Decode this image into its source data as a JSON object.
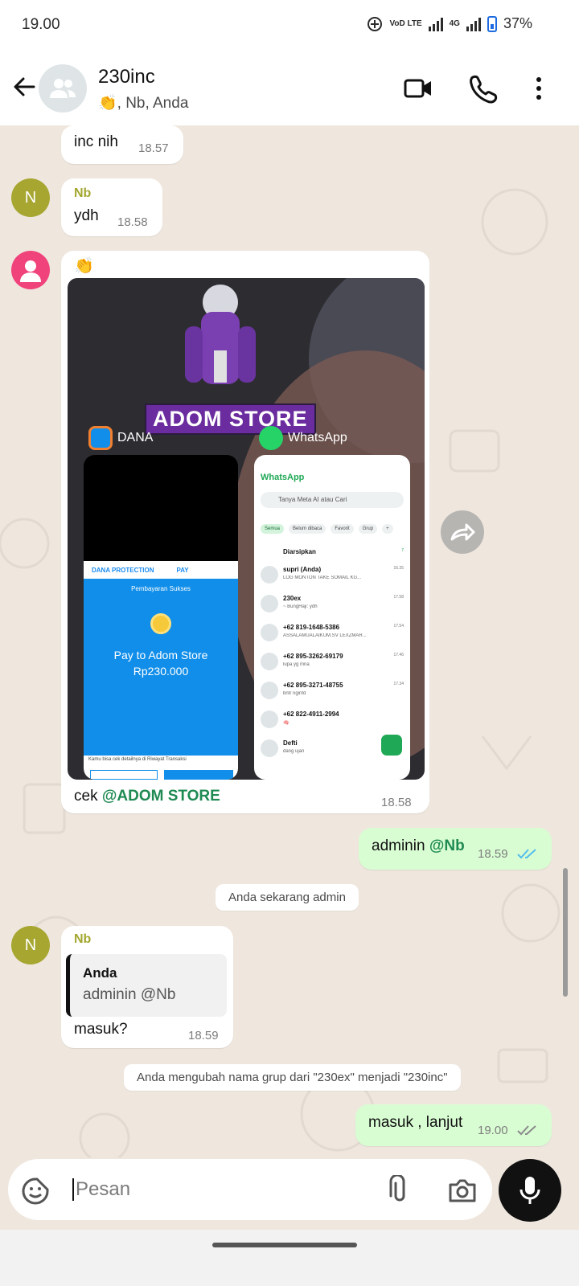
{
  "status_bar": {
    "time": "19.00",
    "network_label": "VoD LTE",
    "network_gen": "4G",
    "battery": "37%"
  },
  "header": {
    "title": "230inc",
    "subtitle": "👏, Nb, Anda"
  },
  "messages": {
    "m1": {
      "text": "inc nih",
      "time": "18.57"
    },
    "m2": {
      "sender": "Nb",
      "avatar_initial": "N",
      "text": "ydh",
      "time": "18.58"
    },
    "m3": {
      "reaction_emoji": "👏",
      "image": {
        "brand": "ADOM STORE",
        "app_left": "DANA",
        "app_right": "WhatsApp",
        "dana": {
          "protection": "DANA PROTECTION",
          "pay": "PAY",
          "status": "Pembayaran Sukses",
          "pay_to": "Pay to Adom Store",
          "amount": "Rp230.000",
          "note": "Kamu bisa cek detailnya di Riwayat Transaksi"
        },
        "whatsapp": {
          "title": "WhatsApp",
          "search_placeholder": "Tanya Meta AI atau Cari",
          "chips": [
            "Semua",
            "Belum dibaca",
            "Favorit",
            "Grup",
            "+"
          ],
          "archived": "Diarsipkan",
          "archived_count": "7",
          "chats": [
            {
              "name": "supri (Anda)",
              "preview": "LOG MONTON TAKE SOMAIL KG...",
              "time": "16.35"
            },
            {
              "name": "230ex",
              "preview": "~ BungHaji: ydh",
              "time": "17.58"
            },
            {
              "name": "+62 819-1648-5386",
              "preview": "ASSALAMUALAIKUM.SV LEXZMAR...",
              "time": "17.54"
            },
            {
              "name": "+62 895-3262-69179",
              "preview": "lupa yg mna",
              "time": "17.46"
            },
            {
              "name": "+62 895-3271-48755",
              "preview": "bntr nginfd",
              "time": "17.34"
            },
            {
              "name": "+62 822-4911-2994",
              "preview": "🧠",
              "time": ""
            },
            {
              "name": "Defti",
              "preview": "dang ujan",
              "time": ""
            }
          ]
        }
      },
      "caption_prefix": "cek ",
      "caption_mention": "@ADOM STORE",
      "time": "18.58"
    },
    "m4": {
      "text": "adminin ",
      "mention": "@Nb",
      "time": "18.59"
    },
    "sys1": "Anda sekarang admin",
    "m5": {
      "sender": "Nb",
      "avatar_initial": "N",
      "quote_author": "Anda",
      "quote_text": "adminin @Nb",
      "text": "masuk?",
      "time": "18.59"
    },
    "sys2": "Anda mengubah nama grup dari \"230ex\" menjadi \"230inc\"",
    "m6": {
      "text": "masuk , lanjut",
      "time": "19.00"
    }
  },
  "input": {
    "placeholder": "Pesan"
  },
  "icons": {
    "back": "arrow-left-icon",
    "video": "video-call-icon",
    "call": "phone-icon",
    "menu": "more-vert-icon",
    "sticker": "sticker-icon",
    "attach": "paperclip-icon",
    "camera": "camera-icon",
    "mic": "mic-icon",
    "forward": "forward-icon"
  },
  "colors": {
    "accent": "#1fa855",
    "outgoing_bubble": "#d9fdd3",
    "mention": "#1f8a52",
    "read_tick": "#53bdeb"
  }
}
